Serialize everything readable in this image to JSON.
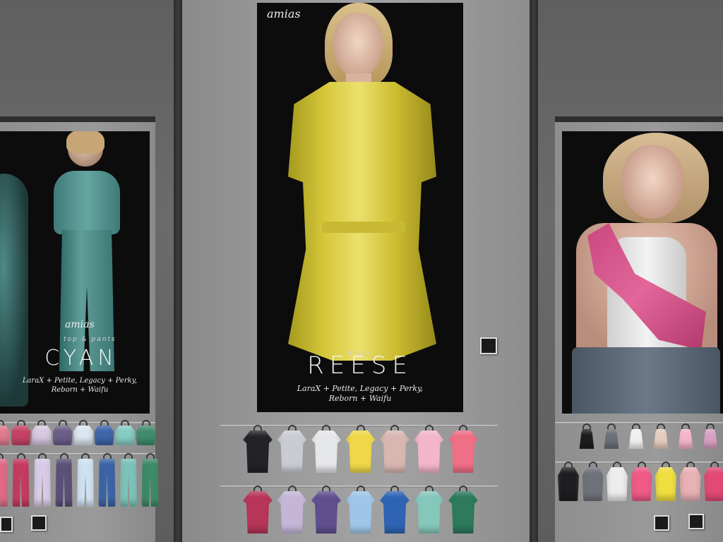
{
  "left_poster": {
    "brand": "amias",
    "kind": "top & pants",
    "title": "CYAN",
    "subtitle_line1": "LaraX + Petite, Legacy + Perky,",
    "subtitle_line2": "Reborn + Waifu"
  },
  "center_poster": {
    "brand_top": "amias",
    "kind": "dress",
    "title": "REESE",
    "subtitle_line1": "LaraX + Petite, Legacy + Perky,",
    "subtitle_line2": "Reborn + Waifu"
  },
  "colors": {
    "center_row1": [
      "#222327",
      "#c9ccd2",
      "#e6e7ea",
      "#f0d74a",
      "#d9b7b1",
      "#f2b6c8",
      "#ef6f86"
    ],
    "center_row2": [
      "#b63558",
      "#c5b6d6",
      "#5f4f8f",
      "#9fc6e8",
      "#2f64b5",
      "#86c7bb",
      "#2d7a5d"
    ],
    "left_tops": [
      "#e07a8f",
      "#c64265",
      "#d8c9e2",
      "#6a5e88",
      "#dbe6f2",
      "#3c65aa",
      "#86cdc4",
      "#3f8d6e"
    ],
    "left_pants": [
      "#df6a87",
      "#c43a60",
      "#d9cbe6",
      "#5b5078",
      "#cfe1f1",
      "#3a64a6",
      "#7bc2b8",
      "#3c8a68"
    ],
    "right_tanks": [
      "#1d1d1f",
      "#6c7078",
      "#f1f1f1",
      "#e5cdbd",
      "#f4b3cc",
      "#d8a0c0"
    ],
    "right_shirts": [
      "#1e1e20",
      "#6f727a",
      "#ececec",
      "#ef5a86",
      "#f1df40",
      "#e7b1b5",
      "#e24a73"
    ]
  }
}
